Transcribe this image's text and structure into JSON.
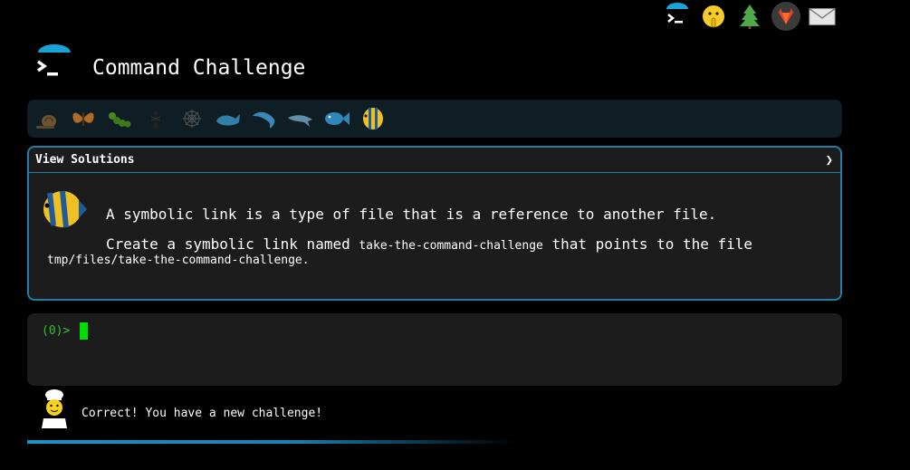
{
  "nav_icons": [
    "terminal-icon",
    "shushing-face-icon",
    "tree-icon",
    "gitlab-icon",
    "mail-icon"
  ],
  "header": {
    "title": "Command Challenge"
  },
  "levels": [
    "snail-icon",
    "butterfly-icon",
    "caterpillar-icon",
    "ant-icon",
    "spider-web-icon",
    "whale-icon",
    "dolphin-icon",
    "dolphin-icon",
    "fish-icon",
    "tropical-fish-icon"
  ],
  "challenge": {
    "view_solutions_label": "View Solutions",
    "chevron": "❯",
    "line1": "A symbolic link is a type of file that is a reference to another file.",
    "line2_prefix": "Create a symbolic link named ",
    "line2_code": "take-the-command-challenge",
    "line2_suffix": " that points to the file",
    "line3_code": "tmp/files/take-the-command-challenge",
    "line3_suffix": "."
  },
  "terminal": {
    "prompt": "(0)>"
  },
  "feedback": {
    "message": "Correct! You have a new challenge!"
  },
  "colors": {
    "accent": "#1f7fa8",
    "prompt_green": "#2cc12c",
    "cursor_green": "#00e000"
  }
}
